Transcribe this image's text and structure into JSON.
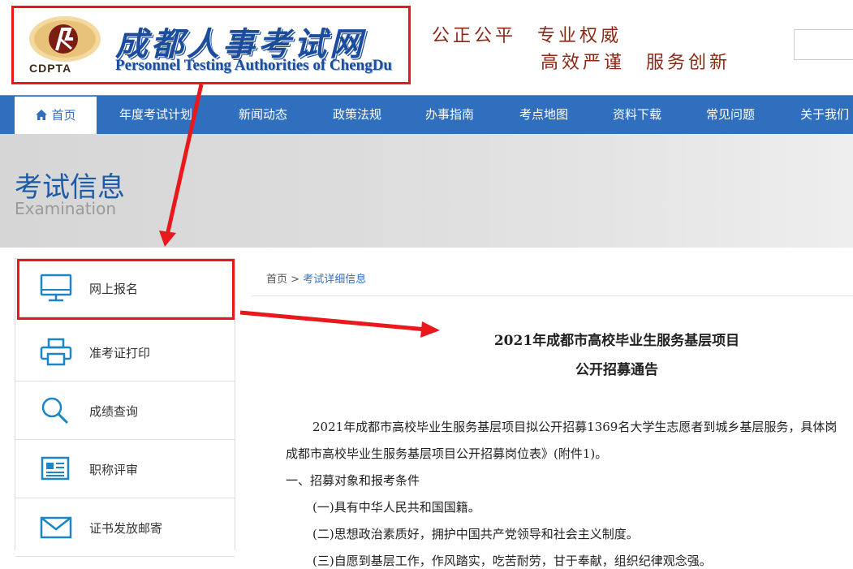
{
  "header": {
    "logo_text_cn": "成都人事考试网",
    "logo_text_en": "Personnel Testing Authorities of ChengDu",
    "logo_abbr": "CDPTA",
    "slogan_line1": "公正公平　专业权威",
    "slogan_line2": "高效严谨　服务创新"
  },
  "nav": {
    "items": [
      {
        "label": "首页",
        "icon": "home-icon",
        "active": true
      },
      {
        "label": "年度考试计划"
      },
      {
        "label": "新闻动态"
      },
      {
        "label": "政策法规"
      },
      {
        "label": "办事指南"
      },
      {
        "label": "考点地图"
      },
      {
        "label": "资料下载"
      },
      {
        "label": "常见问题"
      },
      {
        "label": "关于我们"
      }
    ]
  },
  "banner": {
    "title": "考试信息",
    "subtitle": "Examination"
  },
  "sidebar": {
    "items": [
      {
        "label": "网上报名",
        "icon": "monitor-icon"
      },
      {
        "label": "准考证打印",
        "icon": "printer-icon"
      },
      {
        "label": "成绩查询",
        "icon": "search-icon"
      },
      {
        "label": "职称评审",
        "icon": "document-icon"
      },
      {
        "label": "证书发放邮寄",
        "icon": "envelope-icon"
      }
    ]
  },
  "breadcrumb": {
    "home": "首页",
    "separator": ">",
    "current": "考试详细信息"
  },
  "article": {
    "title_line1": "2021年成都市高校毕业生服务基层项目",
    "title_line2": "公开招募通告",
    "paragraphs": [
      "2021年成都市高校毕业生服务基层项目拟公开招募1369名大学生志愿者到城乡基层服务，具体岗",
      "成都市高校毕业生服务基层项目公开招募岗位表》(附件1)。",
      "一、招募对象和报考条件",
      "(一)具有中华人民共和国国籍。",
      "(二)思想政治素质好，拥护中国共产党领导和社会主义制度。",
      "(三)自愿到基层工作，作风踏实，吃苦耐劳，甘于奉献，组织纪律观念强。"
    ]
  },
  "colors": {
    "nav_blue": "#2f6fbd",
    "logo_blue": "#1c4c9c",
    "slogan_red": "#8a2a16",
    "annotation_red": "#e8181c"
  }
}
